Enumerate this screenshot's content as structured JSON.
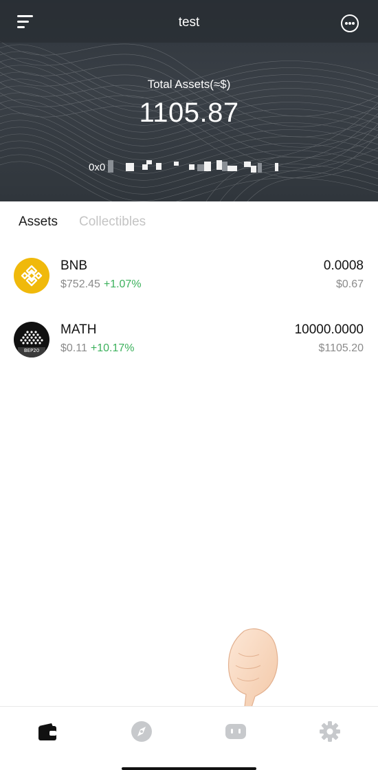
{
  "header": {
    "wallet_name": "test",
    "total_assets_label": "Total Assets(≈$)",
    "total_assets_value": "1105.87",
    "address_prefix": "0x0",
    "icons": {
      "menu": "menu-lines-icon",
      "more": "more-dots-icon"
    }
  },
  "tabs": [
    {
      "label": "Assets",
      "active": true
    },
    {
      "label": "Collectibles",
      "active": false
    }
  ],
  "assets": [
    {
      "symbol": "BNB",
      "price": "$752.45",
      "change": "+1.07%",
      "amount": "0.0008",
      "value_usd": "$0.67",
      "logo_color": "#F0B90B"
    },
    {
      "symbol": "MATH",
      "price": "$0.11",
      "change": "+10.17%",
      "amount": "10000.0000",
      "value_usd": "$1105.20",
      "logo_color": "#111111",
      "logo_badge": "BEP20"
    }
  ],
  "bottom_nav": [
    {
      "name": "wallet",
      "icon": "wallet-icon",
      "active": true
    },
    {
      "name": "discover",
      "icon": "compass-icon",
      "active": false
    },
    {
      "name": "dapp",
      "icon": "robot-face-icon",
      "active": false
    },
    {
      "name": "settings",
      "icon": "gear-icon",
      "active": false
    }
  ],
  "colors": {
    "positive": "#3cb15c",
    "header_bg": "#33393f",
    "inactive_icon": "#c7c9cc"
  }
}
